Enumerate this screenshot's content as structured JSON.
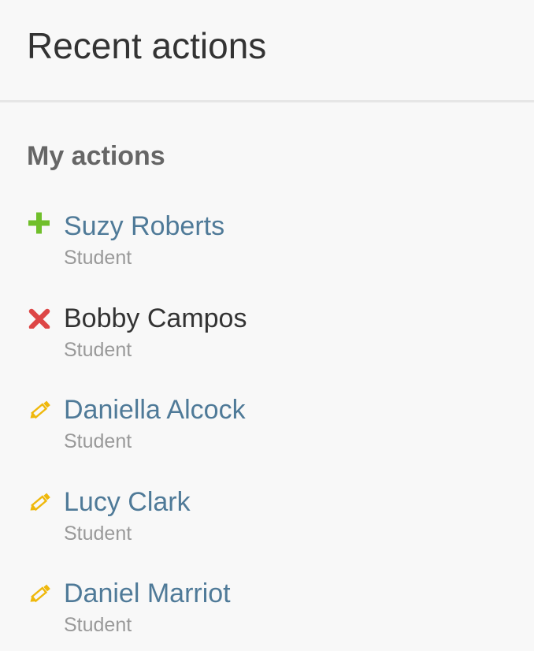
{
  "module": {
    "title": "Recent actions",
    "section_title": "My actions"
  },
  "actions": [
    {
      "name": "Suzy Roberts",
      "type": "Student",
      "icon": "add-icon",
      "state": "added",
      "icon_color": "#70bf2b"
    },
    {
      "name": "Bobby Campos",
      "type": "Student",
      "icon": "delete-icon",
      "state": "deleted",
      "icon_color": "#dd4646"
    },
    {
      "name": "Daniella Alcock",
      "type": "Student",
      "icon": "edit-icon",
      "state": "changed",
      "icon_color": "#efb80b"
    },
    {
      "name": "Lucy Clark",
      "type": "Student",
      "icon": "edit-icon",
      "state": "changed",
      "icon_color": "#efb80b"
    },
    {
      "name": "Daniel Marriot",
      "type": "Student",
      "icon": "edit-icon",
      "state": "changed",
      "icon_color": "#efb80b"
    }
  ],
  "colors": {
    "link": "#4f7a98",
    "muted": "#999999",
    "heading": "#666666",
    "background": "#f8f8f8"
  }
}
